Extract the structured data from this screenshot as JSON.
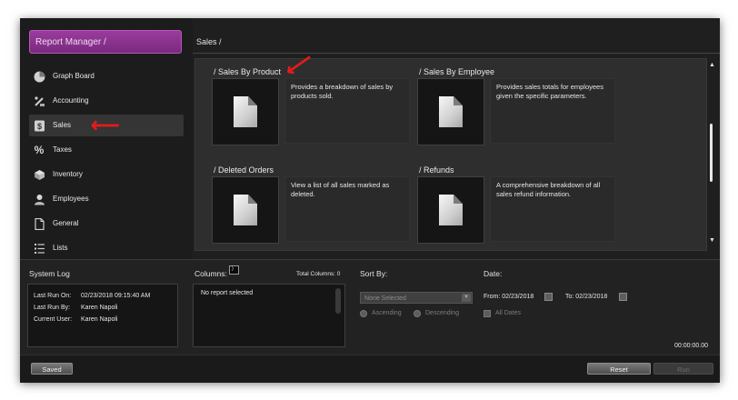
{
  "sidebar": {
    "title": "Report Manager /",
    "items": [
      {
        "label": "Graph Board",
        "icon": "graph-icon"
      },
      {
        "label": "Accounting",
        "icon": "accounting-icon"
      },
      {
        "label": "Sales",
        "icon": "dollar-icon",
        "active": true
      },
      {
        "label": "Taxes",
        "icon": "percent-icon"
      },
      {
        "label": "Inventory",
        "icon": "inventory-icon"
      },
      {
        "label": "Employees",
        "icon": "employee-icon"
      },
      {
        "label": "General",
        "icon": "document-icon"
      },
      {
        "label": "Lists",
        "icon": "list-icon"
      }
    ]
  },
  "main": {
    "breadcrumb": "Sales /",
    "reports": [
      {
        "title": "/ Sales By Product",
        "description": "Provides a breakdown of sales by products sold."
      },
      {
        "title": "/ Sales By Employee",
        "description": "Provides sales totals for employees given the specific parameters."
      },
      {
        "title": "/ Deleted Orders",
        "description": "View a list of all sales marked as deleted."
      },
      {
        "title": "/ Refunds",
        "description": "A comprehensive breakdown of all sales refund information."
      }
    ]
  },
  "system_log": {
    "title": "System Log",
    "last_run_on_label": "Last Run On:",
    "last_run_on_value": "02/23/2018  09:15:40 AM",
    "last_run_by_label": "Last Run By:",
    "last_run_by_value": "Karen Napoli",
    "current_user_label": "Current User:",
    "current_user_value": "Karen Napoli"
  },
  "columns": {
    "title": "Columns:",
    "total_label": "Total Columns: 0",
    "empty_text": "No report selected"
  },
  "sort": {
    "title": "Sort By:",
    "selected": "None Selected",
    "ascending": "Ascending",
    "descending": "Descending"
  },
  "date": {
    "title": "Date:",
    "from_label": "From: 02/23/2018",
    "to_label": "To: 02/23/2018",
    "all_dates": "All Dates",
    "timer": "00:00:00.00"
  },
  "footer": {
    "saved": "Saved",
    "reset": "Reset",
    "run": "Run"
  },
  "colors": {
    "accent": "#8a3590",
    "annotation": "#e31b1b",
    "background": "#1b1b1b"
  }
}
